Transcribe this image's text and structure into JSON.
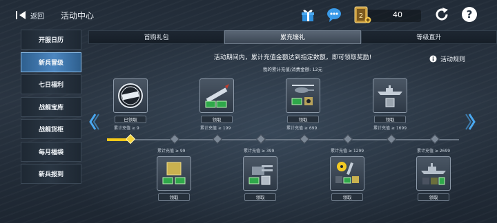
{
  "topbar": {
    "back_label": "返回",
    "title": "活动中心",
    "currency_value": "40",
    "icons": [
      "back-arrow-icon",
      "gift-icon",
      "chat-icon",
      "currency-card-icon",
      "refresh-icon",
      "help-icon"
    ]
  },
  "sidebar": {
    "items": [
      {
        "label": "开服日历",
        "active": false
      },
      {
        "label": "新兵冒级",
        "active": true
      },
      {
        "label": "七日福利",
        "active": false
      },
      {
        "label": "战舰宝库",
        "active": false
      },
      {
        "label": "战舰货柜",
        "active": false
      },
      {
        "label": "每月福袋",
        "active": false
      },
      {
        "label": "新兵报到",
        "active": false
      }
    ]
  },
  "tabs": [
    {
      "label": "首购礼包",
      "active": false
    },
    {
      "label": "累充壕礼",
      "active": true
    },
    {
      "label": "等级直升",
      "active": false
    }
  ],
  "description": "活动期间内，累计充值金额达到指定数额，即可领取奖励!",
  "rules_label": "活动规则",
  "cumulative_text": "我的累计充值/消费金额: 12元",
  "rewards_top": [
    {
      "button": "已领取",
      "label": "累计充值 ≥ 9",
      "claimed": true
    },
    {
      "button": "领取",
      "label": "累计充值 ≥ 199",
      "claimed": false
    },
    {
      "button": "领取",
      "label": "累计充值 ≥ 699",
      "claimed": false
    },
    {
      "button": "领取",
      "label": "累计充值 ≥ 1699",
      "claimed": false
    }
  ],
  "rewards_bottom": [
    {
      "button": "领取",
      "label": "累计充值 ≥ 99",
      "claimed": false
    },
    {
      "button": "领取",
      "label": "累计充值 ≥ 399",
      "claimed": false
    },
    {
      "button": "领取",
      "label": "累计充值 ≥ 1299",
      "claimed": false
    },
    {
      "button": "领取",
      "label": "累计充值 ≥ 2699",
      "claimed": false
    }
  ],
  "progress": {
    "milestones_total": 8,
    "milestones_reached": 1
  },
  "colors": {
    "accent": "#4c86c0",
    "progress": "#f6c919",
    "money": "#2fa84a"
  }
}
